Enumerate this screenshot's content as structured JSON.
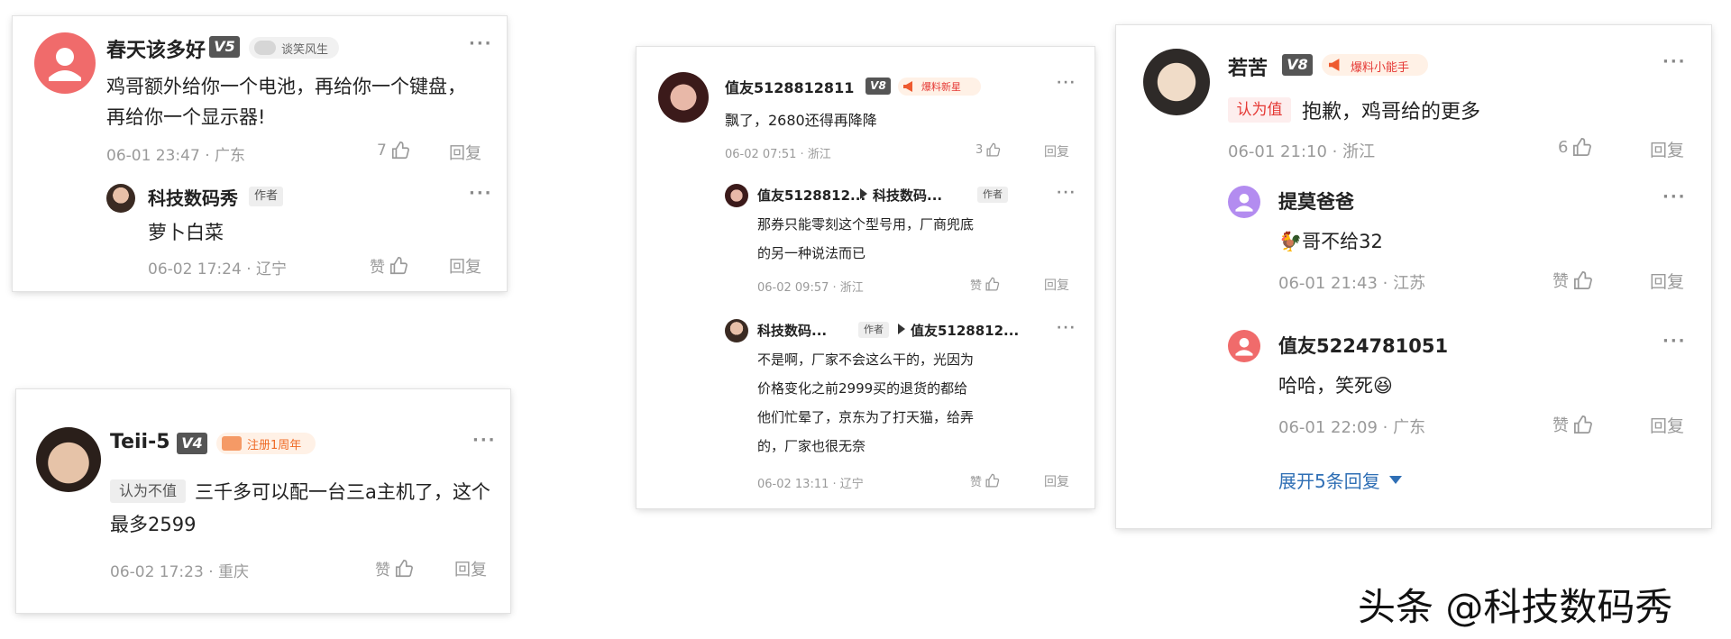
{
  "card1": {
    "author": "春天该多好",
    "level": "V5",
    "badge": "谈笑风生",
    "text_line1": "鸡哥额外给你一个电池，再给你一个键盘，",
    "text_line2": "再给你一个显示器!",
    "time_location": "06-01 23:47 · 广东",
    "like_count": "7",
    "reply_label": "回复",
    "reply": {
      "author": "科技数码秀",
      "author_badge": "作者",
      "text": "萝卜白菜",
      "time_location": "06-02 17:24 · 辽宁",
      "like_label": "赞",
      "reply_label": "回复"
    }
  },
  "card2": {
    "author": "Teii-5",
    "level": "V4",
    "badge": "注册1周年",
    "opinion": "认为不值",
    "text_line1": "三千多可以配一台三a主机了，这个",
    "text_line2": "最多2599",
    "time_location": "06-02 17:23 · 重庆",
    "like_label": "赞",
    "reply_label": "回复"
  },
  "card3": {
    "author": "值友5128812811",
    "level": "V8",
    "badge": "爆料新星",
    "text": "飘了，2680还得再降降",
    "time_location": "06-02 07:51 · 浙江",
    "like_count": "3",
    "reply_label": "回复",
    "replies": [
      {
        "from": "值友5128812...",
        "to": "科技数码...",
        "to_badge": "作者",
        "line1": "那券只能零刻这个型号用，厂商兜底",
        "line2": "的另一种说法而已",
        "time_location": "06-02 09:57 · 浙江",
        "like_label": "赞",
        "reply_label": "回复"
      },
      {
        "from": "科技数码...",
        "from_badge": "作者",
        "to": "值友5128812...",
        "line1": "不是啊，厂家不会这么干的，光因为",
        "line2": "价格变化之前2999买的退货的都给",
        "line3": "他们忙晕了，京东为了打天猫，给弄",
        "line4": "的，厂家也很无奈",
        "time_location": "06-02 13:11 · 辽宁",
        "like_label": "赞",
        "reply_label": "回复"
      }
    ]
  },
  "card4": {
    "author": "若苦",
    "level": "V8",
    "badge": "爆料小能手",
    "opinion": "认为值",
    "text": "抱歉，鸡哥给的更多",
    "time_location": "06-01 21:10 · 浙江",
    "like_count": "6",
    "reply_label": "回复",
    "replies": [
      {
        "author": "提莫爸爸",
        "emoji": "🐓",
        "text": "哥不给32",
        "time_location": "06-01 21:43 · 江苏",
        "like_label": "赞",
        "reply_label": "回复"
      },
      {
        "author": "值友5224781051",
        "text": "哈哈，笑死",
        "emoji": "😆",
        "time_location": "06-01 22:09 · 广东",
        "like_label": "赞",
        "reply_label": "回复"
      }
    ],
    "expand_label": "展开5条回复"
  },
  "more_glyph": "···",
  "watermark": "头条 @科技数码秀",
  "colors": {
    "level_badge": "#555555",
    "opinion_red": "#e53935",
    "expand_blue": "#2f6fb5",
    "meta_gray": "#9a9a9a"
  },
  "icons": [
    "thumb-up-icon",
    "more-icon",
    "megaphone-icon",
    "chevron-down-icon",
    "default-avatar-icon"
  ]
}
